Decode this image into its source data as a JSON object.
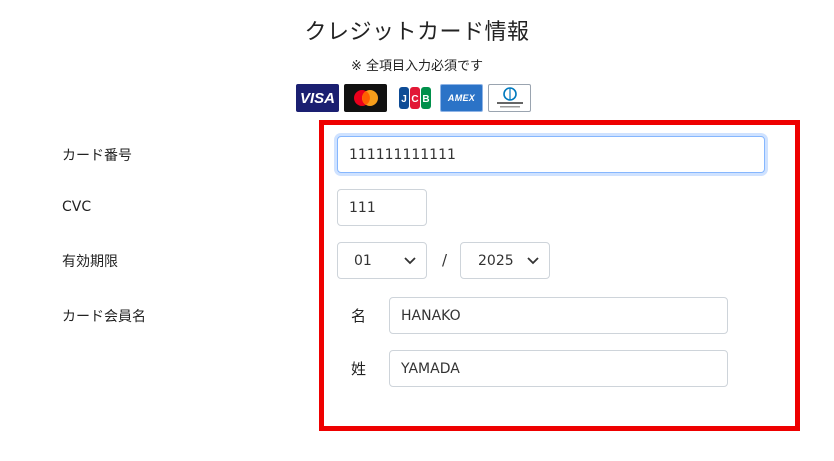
{
  "header": {
    "title": "クレジットカード情報",
    "note": "※ 全項目入力必須です"
  },
  "card_brands": {
    "visa": "VISA",
    "mastercard": "mastercard-logo",
    "jcb": "JCB",
    "amex": "AMEX",
    "diners": "diners-club-logo"
  },
  "form": {
    "card_number": {
      "label": "カード番号",
      "value": "111111111111"
    },
    "cvc": {
      "label": "CVC",
      "value": "111"
    },
    "expiry": {
      "label": "有効期限",
      "month": "01",
      "separator": "/",
      "year": "2025"
    },
    "cardholder": {
      "label": "カード会員名",
      "first_name_label": "名",
      "first_name": "HANAKO",
      "last_name_label": "姓",
      "last_name": "YAMADA"
    }
  },
  "colors": {
    "highlight_border": "#ee0000",
    "visa_blue": "#1a1f71",
    "amex_blue": "#2b73c7"
  }
}
